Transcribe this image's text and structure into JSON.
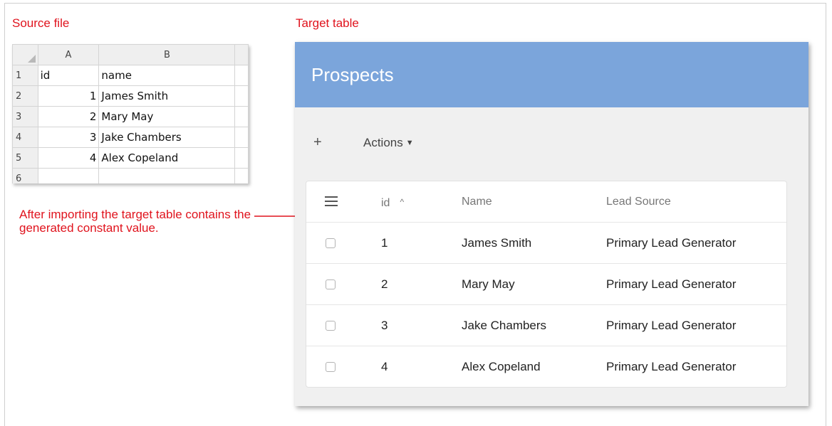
{
  "labels": {
    "source": "Source file",
    "target": "Target table",
    "annotation": "After importing the target table contains the generated constant value."
  },
  "spreadsheet": {
    "columns": [
      "A",
      "B"
    ],
    "row_numbers": [
      "1",
      "2",
      "3",
      "4",
      "5",
      "6"
    ],
    "rows": [
      [
        "id",
        "name"
      ],
      [
        "1",
        "James Smith"
      ],
      [
        "2",
        "Mary May"
      ],
      [
        "3",
        "Jake Chambers"
      ],
      [
        "4",
        "Alex Copeland"
      ],
      [
        "",
        ""
      ]
    ]
  },
  "app": {
    "title": "Prospects",
    "toolbar": {
      "add": "+",
      "actions": "Actions",
      "actions_caret": "▼"
    },
    "grid": {
      "headers": {
        "id": "id",
        "sort_indicator": "^",
        "name": "Name",
        "lead_source": "Lead Source"
      },
      "rows": [
        {
          "id": "1",
          "name": "James Smith",
          "lead_source": "Primary Lead Generator"
        },
        {
          "id": "2",
          "name": "Mary May",
          "lead_source": "Primary Lead Generator"
        },
        {
          "id": "3",
          "name": "Jake Chambers",
          "lead_source": "Primary Lead Generator"
        },
        {
          "id": "4",
          "name": "Alex Copeland",
          "lead_source": "Primary Lead Generator"
        }
      ]
    }
  },
  "colors": {
    "annotation_red": "#e0131d",
    "header_blue": "#7ba5db"
  }
}
